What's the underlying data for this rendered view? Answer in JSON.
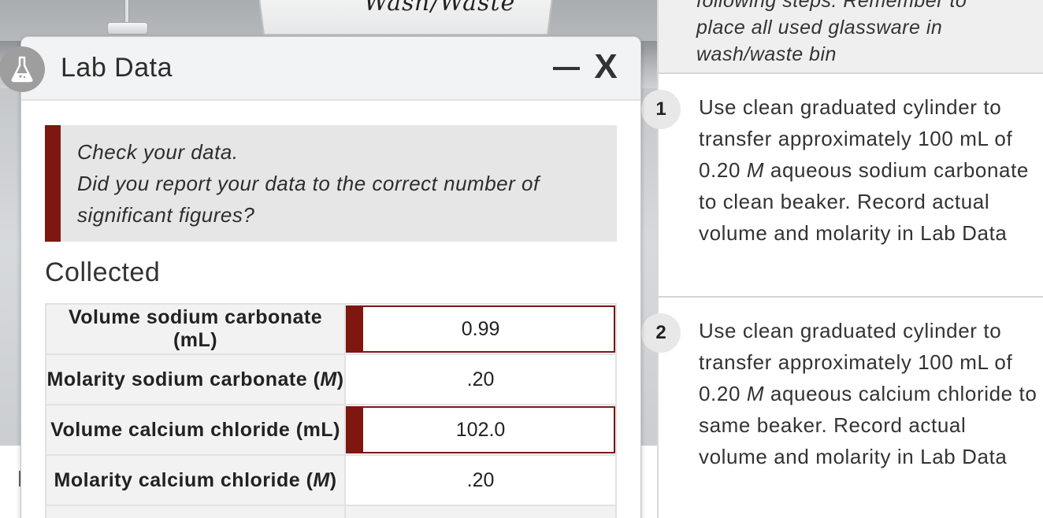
{
  "scene": {
    "waste_bin_label": "Wash/Waste"
  },
  "instructions": {
    "intro_lines": [
      "following steps. Remember to",
      "place all used glassware in",
      "wash/waste bin"
    ],
    "steps": [
      {
        "number": "1",
        "text_before": "Use clean graduated cylinder to transfer approximately 100 mL of 0.20 ",
        "unit": "M",
        "text_after": " aqueous sodium carbonate to clean beaker. Record actual volume and molarity in Lab Data"
      },
      {
        "number": "2",
        "text_before": "Use clean graduated cylinder to transfer approximately 100 mL of 0.20 ",
        "unit": "M",
        "text_after": " aqueous calcium chloride to same beaker. Record actual volume and molarity in Lab Data"
      }
    ]
  },
  "dialog": {
    "title": "Lab Data",
    "icon": "flask-icon",
    "minimize_icon": "minimize-icon",
    "close_label": "X",
    "alert": {
      "line1": "Check your data.",
      "line2": "Did you report your data to the correct number of significant figures?"
    },
    "section_title": "Collected",
    "rows": [
      {
        "label_before": "Volume sodium carbonate (mL)",
        "unit": "",
        "label_after": "",
        "value": "0.99",
        "flagged": true
      },
      {
        "label_before": "Molarity sodium carbonate (",
        "unit": "M",
        "label_after": ")",
        "value": ".20",
        "flagged": false
      },
      {
        "label_before": "Volume calcium chloride (mL)",
        "unit": "",
        "label_after": "",
        "value": "102.0",
        "flagged": true
      },
      {
        "label_before": "Molarity calcium chloride (",
        "unit": "M",
        "label_after": ")",
        "value": ".20",
        "flagged": false
      }
    ]
  },
  "colors": {
    "alert_accent": "#7d1710",
    "badge": "#9e9e9e"
  }
}
